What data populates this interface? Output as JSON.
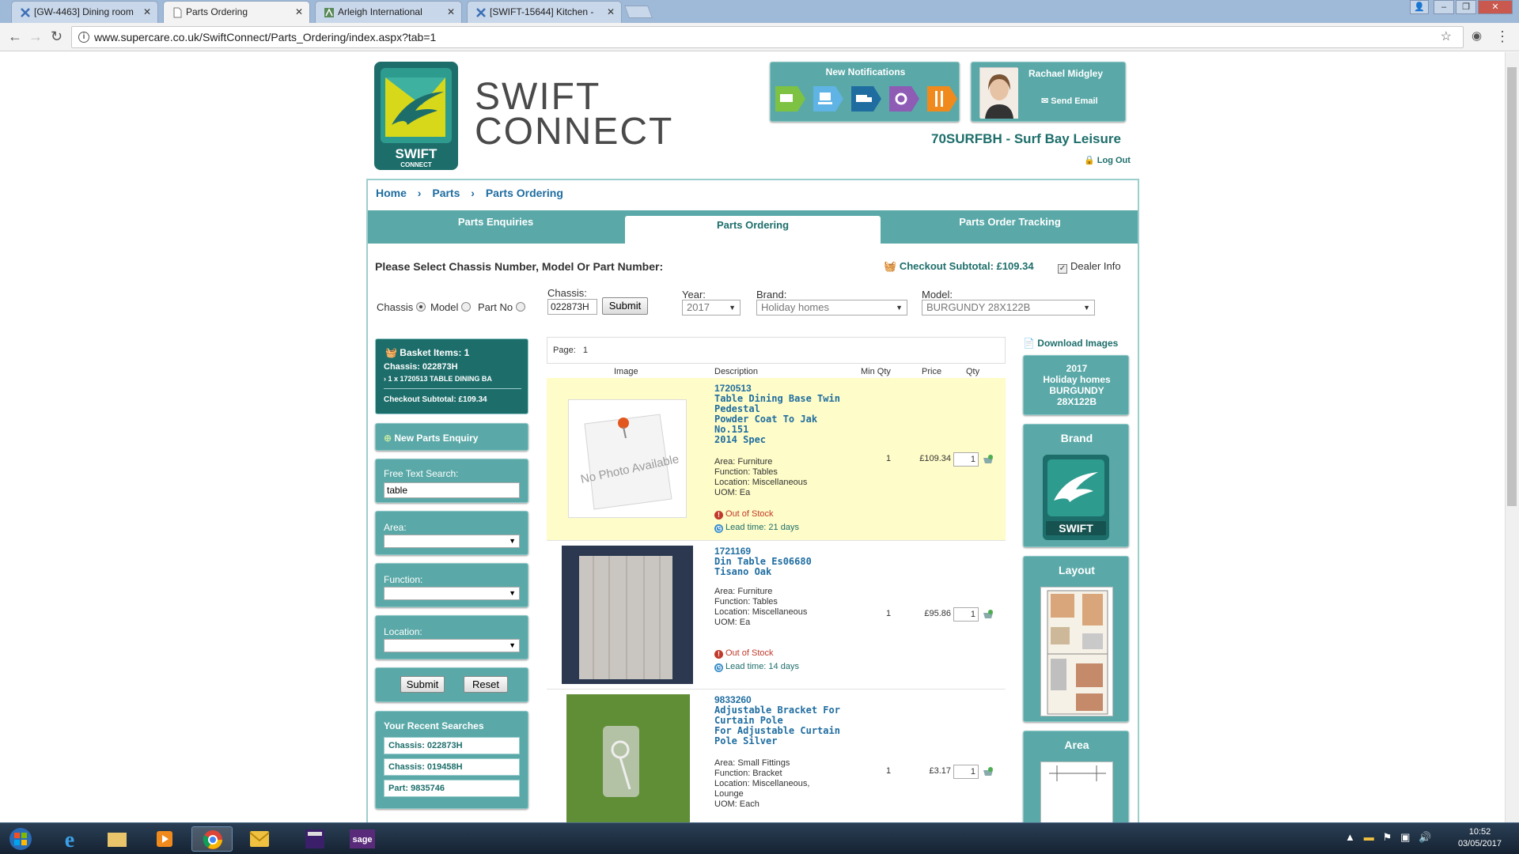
{
  "browser": {
    "tabs": [
      {
        "title": "[GW-4463] Dining room"
      },
      {
        "title": "Parts Ordering"
      },
      {
        "title": "Arleigh International"
      },
      {
        "title": "[SWIFT-15644] Kitchen -"
      }
    ],
    "url": "www.supercare.co.uk/SwiftConnect/Parts_Ordering/index.aspx?tab=1"
  },
  "header": {
    "logo_text": "SWIFT",
    "logo_sub": "CONNECT",
    "brand_line1": "SWIFT",
    "brand_line2": "CONNECT",
    "notifications_title": "New Notifications",
    "user_name": "Rachael Midgley",
    "send_email": "Send Email",
    "dealer": "70SURFBH - Surf Bay Leisure",
    "logout": "Log Out"
  },
  "breadcrumb": [
    "Home",
    "Parts",
    "Parts Ordering"
  ],
  "tabs": [
    "Parts Enquiries",
    "Parts Ordering",
    "Parts Order Tracking"
  ],
  "form": {
    "title": "Please Select Chassis Number, Model Or Part Number:",
    "checkout_subtotal": "Checkout Subtotal: £109.34",
    "dealer_info": "Dealer Info",
    "radio_chassis": "Chassis",
    "radio_model": "Model",
    "radio_part": "Part No",
    "chassis_label": "Chassis:",
    "chassis_value": "022873H",
    "submit": "Submit",
    "year_label": "Year:",
    "year_value": "2017",
    "brand_label": "Brand:",
    "brand_value": "Holiday homes",
    "model_label": "Model:",
    "model_value": "BURGUNDY 28X122B"
  },
  "basket": {
    "items": "Basket Items: 1",
    "chassis": "Chassis: 022873H",
    "line": "1 x 1720513 TABLE DINING BA",
    "subtotal": "Checkout Subtotal: £109.34"
  },
  "left": {
    "new_enquiry": "New Parts Enquiry",
    "free_text_label": "Free Text Search:",
    "free_text_value": "table",
    "area_label": "Area:",
    "function_label": "Function:",
    "location_label": "Location:",
    "submit": "Submit",
    "reset": "Reset",
    "recent_title": "Your Recent Searches",
    "recent": [
      "Chassis: 022873H",
      "Chassis: 019458H",
      "Part: 9835746"
    ]
  },
  "results": {
    "page_label": "Page:",
    "page_num": "1",
    "headers": [
      "Image",
      "Description",
      "Min Qty",
      "Price",
      "Qty"
    ],
    "no_photo": "No Photo Available",
    "rows": [
      {
        "code": "1720513",
        "desc_lines": [
          "Table Dining Base Twin",
          "Pedestal",
          "Powder Coat To Jak",
          "No.151",
          "2014 Spec"
        ],
        "attr_lines": [
          "Area: Furniture",
          "Function: Tables",
          "Location: Miscellaneous",
          "UOM: Ea"
        ],
        "stock": "Out of Stock",
        "lead": "Lead time: 21 days",
        "min_qty": "1",
        "price": "£109.34",
        "qty": "1"
      },
      {
        "code": "1721169",
        "desc_lines": [
          "Din Table Es06680",
          "Tisano Oak"
        ],
        "attr_lines": [
          "Area: Furniture",
          "Function: Tables",
          "Location: Miscellaneous",
          "UOM: Ea"
        ],
        "stock": "Out of Stock",
        "lead": "Lead time: 14 days",
        "min_qty": "1",
        "price": "£95.86",
        "qty": "1"
      },
      {
        "code": "9833260",
        "desc_lines": [
          "Adjustable Bracket For",
          "Curtain Pole",
          "For Adjustable Curtain",
          "Pole Silver"
        ],
        "attr_lines": [
          "Area: Small Fittings",
          "Function: Bracket",
          "Location: Miscellaneous,",
          "Lounge",
          "UOM: Each"
        ],
        "min_qty": "1",
        "price": "£3.17",
        "qty": "1"
      }
    ]
  },
  "right": {
    "download": "Download Images",
    "model_lines": [
      "2017",
      "Holiday homes",
      "BURGUNDY",
      "28X122B"
    ],
    "brand_title": "Brand",
    "brand_logo_text": "SWIFT",
    "layout_title": "Layout",
    "area_title": "Area"
  },
  "taskbar": {
    "time": "10:52",
    "date": "03/05/2017"
  },
  "colors": {
    "teal": "#5aa9a8",
    "dark_teal": "#1d6e6b",
    "link_blue": "#1f6da0",
    "highlight_row": "#fefcc8"
  }
}
